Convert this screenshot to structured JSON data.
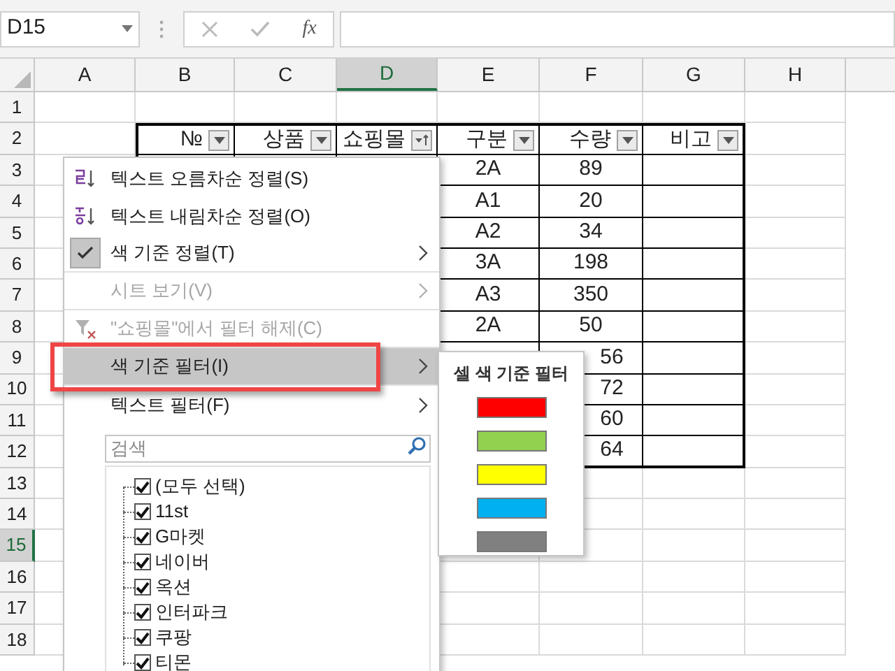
{
  "name_box": {
    "value": "D15"
  },
  "formula_bar": {
    "function_label": "fx"
  },
  "columns": [
    {
      "label": "A",
      "selected": false
    },
    {
      "label": "B",
      "selected": false
    },
    {
      "label": "C",
      "selected": false
    },
    {
      "label": "D",
      "selected": true
    },
    {
      "label": "E",
      "selected": false
    },
    {
      "label": "F",
      "selected": false
    },
    {
      "label": "G",
      "selected": false
    },
    {
      "label": "H",
      "selected": false
    }
  ],
  "row_headers": [
    {
      "label": "1",
      "selected": false
    },
    {
      "label": "2",
      "selected": false
    },
    {
      "label": "3",
      "selected": false
    },
    {
      "label": "4",
      "selected": false
    },
    {
      "label": "5",
      "selected": false
    },
    {
      "label": "6",
      "selected": false
    },
    {
      "label": "7",
      "selected": false
    },
    {
      "label": "8",
      "selected": false
    },
    {
      "label": "9",
      "selected": false
    },
    {
      "label": "10",
      "selected": false
    },
    {
      "label": "11",
      "selected": false
    },
    {
      "label": "12",
      "selected": false
    },
    {
      "label": "13",
      "selected": false
    },
    {
      "label": "14",
      "selected": false
    },
    {
      "label": "15",
      "selected": true
    },
    {
      "label": "16",
      "selected": false
    },
    {
      "label": "17",
      "selected": false
    },
    {
      "label": "18",
      "selected": false
    }
  ],
  "table": {
    "headers": [
      {
        "label": "№",
        "filtered": false
      },
      {
        "label": "상품",
        "filtered": false
      },
      {
        "label": "쇼핑몰",
        "filtered": true
      },
      {
        "label": "구분",
        "filtered": false
      },
      {
        "label": "수량",
        "filtered": false
      },
      {
        "label": "비고",
        "filtered": false
      }
    ],
    "rows": [
      {
        "category": "2A",
        "quantity": "89",
        "clipped": false
      },
      {
        "category": "A1",
        "quantity": "20",
        "clipped": false
      },
      {
        "category": "A2",
        "quantity": "34",
        "clipped": false
      },
      {
        "category": "3A",
        "quantity": "198",
        "clipped": false
      },
      {
        "category": "A3",
        "quantity": "350",
        "clipped": false
      },
      {
        "category": "2A",
        "quantity": "50",
        "clipped": false
      },
      {
        "quantity": "56",
        "clipped": true
      },
      {
        "quantity": "72",
        "clipped": true
      },
      {
        "quantity": "60",
        "clipped": true
      },
      {
        "quantity": "64",
        "clipped": true
      }
    ]
  },
  "filter_menu": {
    "items": [
      {
        "kind": "sort_asc",
        "label": "텍스트 오름차순 정렬(S)",
        "disabled": false,
        "checked": false,
        "submenu": false,
        "selected": false
      },
      {
        "kind": "sort_desc",
        "label": "텍스트 내림차순 정렬(O)",
        "disabled": false,
        "checked": false,
        "submenu": false,
        "selected": false
      },
      {
        "kind": "plain",
        "label": "색 기준 정렬(T)",
        "disabled": false,
        "checked": true,
        "submenu": true,
        "selected": false
      },
      {
        "kind": "plain",
        "label": "시트 보기(V)",
        "disabled": true,
        "checked": false,
        "submenu": true,
        "selected": false
      },
      {
        "kind": "clear_filter",
        "label": "\"쇼핑몰\"에서 필터 해제(C)",
        "disabled": true,
        "checked": false,
        "submenu": false,
        "selected": false
      },
      {
        "kind": "plain",
        "label": "색 기준 필터(I)",
        "disabled": false,
        "checked": false,
        "submenu": true,
        "selected": true
      },
      {
        "kind": "plain",
        "label": "텍스트 필터(F)",
        "disabled": false,
        "checked": false,
        "submenu": true,
        "selected": false
      }
    ],
    "search": {
      "placeholder": "검색"
    },
    "values": [
      {
        "label": "(모두 선택)",
        "checked": true
      },
      {
        "label": "11st",
        "checked": true
      },
      {
        "label": "G마켓",
        "checked": true
      },
      {
        "label": "네이버",
        "checked": true
      },
      {
        "label": "옥션",
        "checked": true
      },
      {
        "label": "인터파크",
        "checked": true
      },
      {
        "label": "쿠팡",
        "checked": true
      },
      {
        "label": "티몬",
        "checked": true
      }
    ]
  },
  "color_submenu": {
    "title": "셀 색 기준 필터",
    "swatches": [
      {
        "color": "#ff0000"
      },
      {
        "color": "#92d050"
      },
      {
        "color": "#ffff00"
      },
      {
        "color": "#00b0f0"
      },
      {
        "color": "#808080"
      }
    ]
  }
}
